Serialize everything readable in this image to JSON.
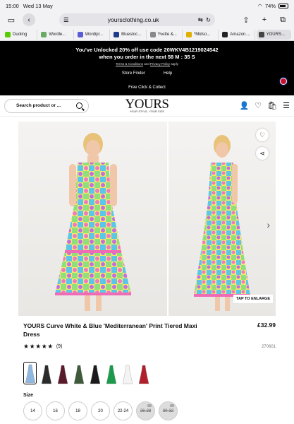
{
  "status": {
    "time": "15:00",
    "date": "Wed 13 May",
    "battery": "74%"
  },
  "browser": {
    "url": "yoursclothing.co.uk",
    "tabs": [
      {
        "label": "Duoling",
        "fav": "#58cc02",
        "active": false
      },
      {
        "label": "Wordle...",
        "fav": "#6aaa64",
        "active": false
      },
      {
        "label": "Wordipl...",
        "fav": "#5b5bd6",
        "active": false
      },
      {
        "label": "Bluestoc...",
        "fav": "#1e3a8a",
        "active": false
      },
      {
        "label": "Yvette &...",
        "fav": "#888888",
        "active": false
      },
      {
        "label": "*Midso...",
        "fav": "#e0b000",
        "active": false
      },
      {
        "label": "Amazon....",
        "fav": "#222222",
        "active": false
      },
      {
        "label": "YOURS...",
        "fav": "#444444",
        "active": true
      }
    ]
  },
  "promo": {
    "line1": "You've Unlocked 20% off use code 20WKV4B1219024542",
    "line2": "when you order in the next  58 M : 35 S",
    "terms_link": "Terms & Conditions",
    "terms_and": " and ",
    "privacy_link": "Privacy Policy",
    "terms_tail": " apply",
    "store_finder": "Store Finder",
    "help": "Help",
    "click_collect": "Free Click & Collect"
  },
  "header": {
    "search_placeholder": "Search product or ...",
    "logo": "YOURS",
    "logo_tagline": "YOUR STYLE, YOUR SIZE"
  },
  "gallery": {
    "enlarge": "TAP TO ENLARGE"
  },
  "product": {
    "title": "YOURS Curve White & Blue 'Mediterranean' Print Tiered Maxi Dress",
    "price": "£32.99",
    "stars": "★★★★★",
    "review_count": "(9)",
    "sku": "270601",
    "swatch_colors": [
      "#8fb7e0",
      "#2b2b2b",
      "#5a1a2a",
      "#3f5a3a",
      "#1a1a1a",
      "#1a9a4a",
      "#f4f4f4",
      "#b01f2a"
    ],
    "size_label": "Size",
    "sizes": [
      {
        "label": "14",
        "oos": false
      },
      {
        "label": "16",
        "oos": false
      },
      {
        "label": "18",
        "oos": false
      },
      {
        "label": "20",
        "oos": false
      },
      {
        "label": "22-24",
        "oos": false
      },
      {
        "label": "26-28",
        "oos": true
      },
      {
        "label": "30-32",
        "oos": true
      }
    ]
  }
}
